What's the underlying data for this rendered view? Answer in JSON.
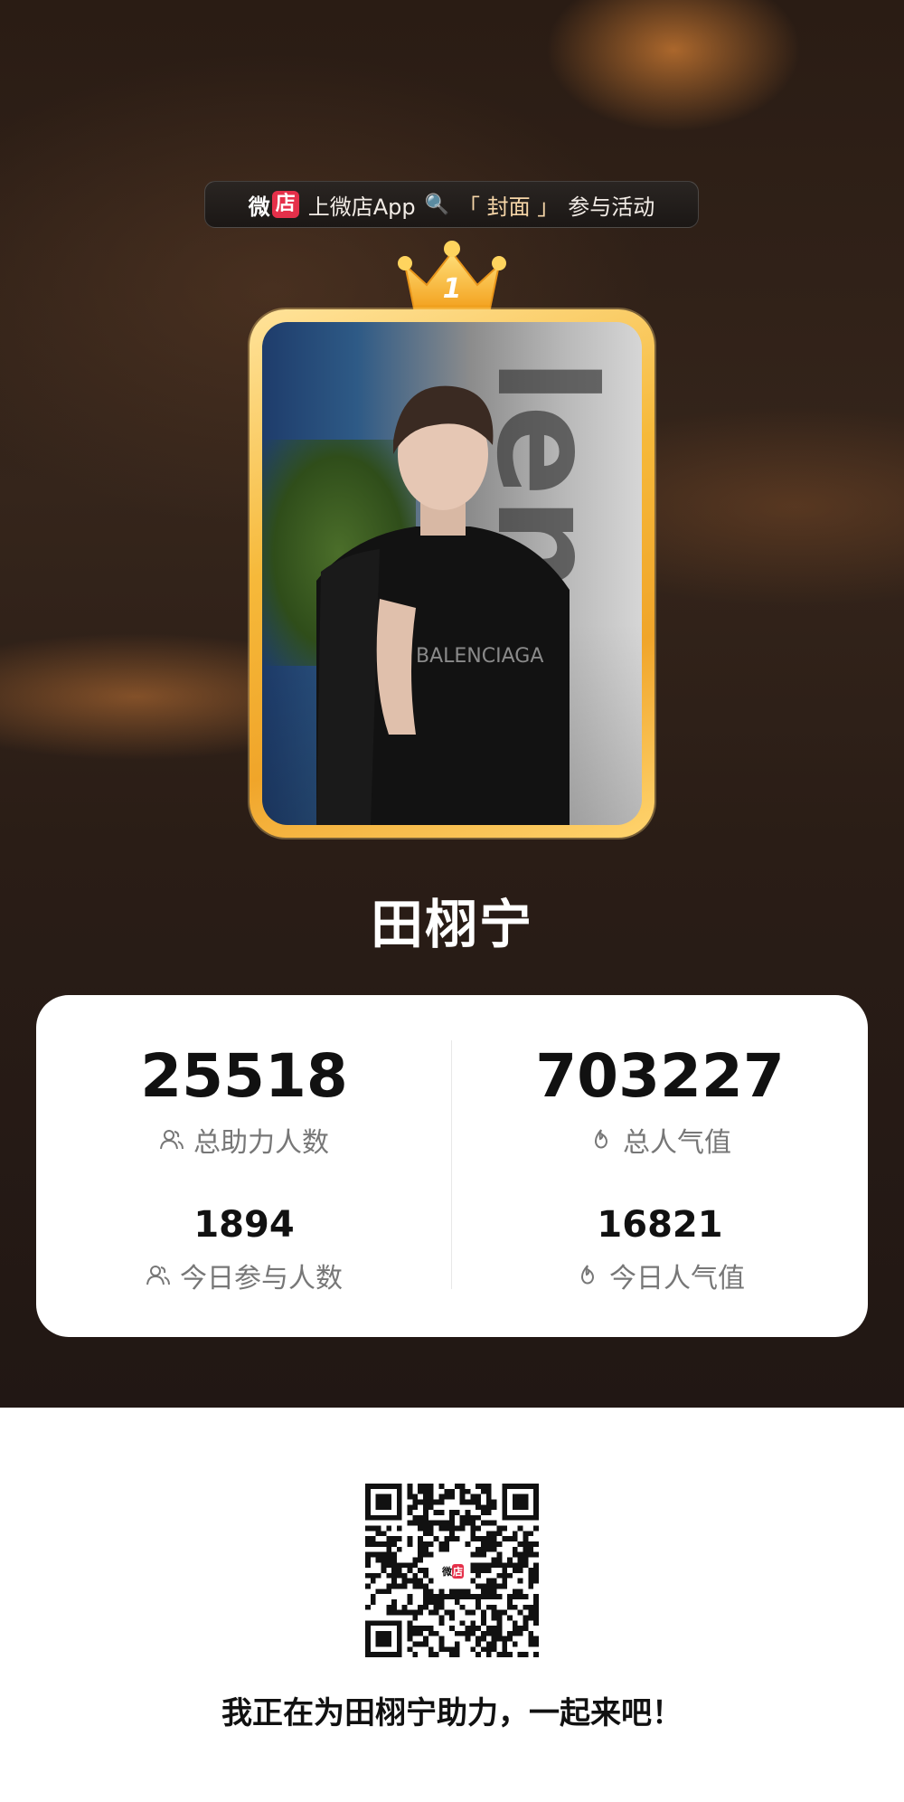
{
  "banner": {
    "brand_wei": "微",
    "brand_dian": "店",
    "prefix": "上微店App",
    "bracket_open": "「",
    "keyword": "封面",
    "bracket_close": "」",
    "suffix": "参与活动",
    "search_icon": "magnifier-icon"
  },
  "rank": {
    "number": "1",
    "icon": "crown-icon"
  },
  "profile": {
    "name": "田栩宁"
  },
  "stats": {
    "total_supporters": {
      "value": "25518",
      "label": "总助力人数",
      "icon": "people-icon"
    },
    "total_popularity": {
      "value": "703227",
      "label": "总人气值",
      "icon": "flame-icon"
    },
    "today_participants": {
      "value": "1894",
      "label": "今日参与人数",
      "icon": "people-icon"
    },
    "today_popularity": {
      "value": "16821",
      "label": "今日人气值",
      "icon": "flame-icon"
    }
  },
  "qr": {
    "logo_wei": "微",
    "logo_dian": "店"
  },
  "cta": {
    "text": "我正在为田栩宁助力，一起来吧！"
  },
  "colors": {
    "accent_gold": "#f6b93a",
    "brand_red": "#e5304a",
    "hero_bg": "#2a1d16"
  }
}
